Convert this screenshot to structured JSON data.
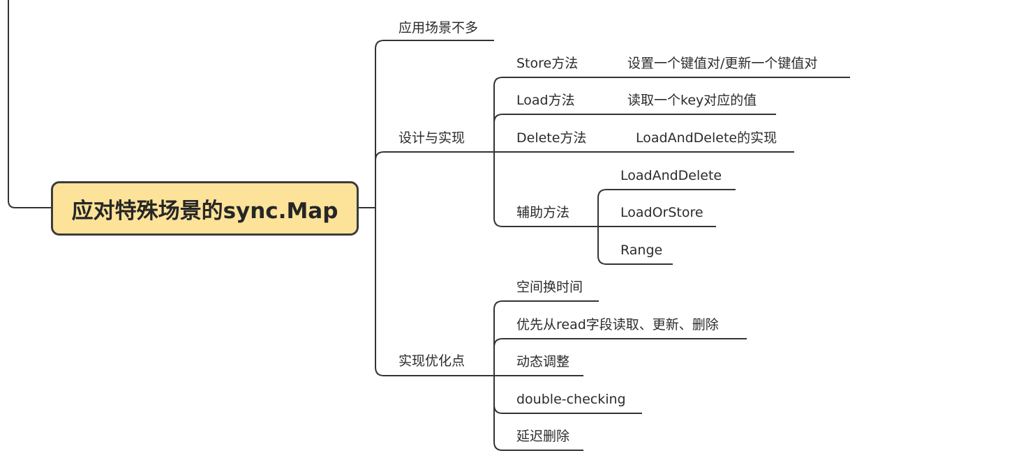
{
  "mindmap": {
    "root": "应对特殊场景的sync.Map",
    "branches": {
      "scenario": "应用场景不多",
      "design": {
        "label": "设计与实现",
        "store": {
          "label": "Store方法",
          "detail": "设置一个键值对/更新一个键值对"
        },
        "load": {
          "label": "Load方法",
          "detail": "读取一个key对应的值"
        },
        "delete": {
          "label": "Delete方法",
          "detail": "LoadAndDelete的实现"
        },
        "helpers": {
          "label": "辅助方法",
          "items": [
            "LoadAndDelete",
            "LoadOrStore",
            "Range"
          ]
        }
      },
      "optimization": {
        "label": "实现优化点",
        "items": [
          "空间换时间",
          "优先从read字段读取、更新、删除",
          "动态调整",
          "double-checking",
          "延迟删除"
        ]
      }
    }
  }
}
